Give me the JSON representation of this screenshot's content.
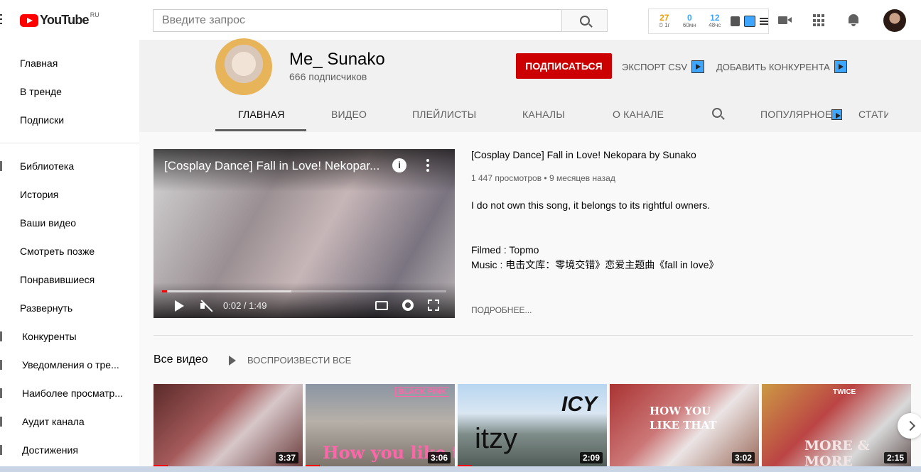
{
  "header": {
    "logo_text": "YouTube",
    "logo_region": "RU",
    "search_placeholder": "Введите запрос",
    "stats": [
      {
        "value": "27",
        "label": "⏱ 1г",
        "color": "#f0a000"
      },
      {
        "value": "0",
        "label": "60мн",
        "color": "#3ea6ff"
      },
      {
        "value": "12",
        "label": "48чс",
        "color": "#3ea6ff"
      }
    ]
  },
  "sidebar": {
    "items": [
      {
        "label": "Главная"
      },
      {
        "label": "В тренде"
      },
      {
        "label": "Подписки"
      },
      {
        "label": "Библиотека"
      },
      {
        "label": "История"
      },
      {
        "label": "Ваши видео"
      },
      {
        "label": "Смотреть позже"
      },
      {
        "label": "Понравившиеся"
      },
      {
        "label": "Развернуть"
      },
      {
        "label": "Конкуренты"
      },
      {
        "label": "Уведомления о тре..."
      },
      {
        "label": "Наиболее просматр..."
      },
      {
        "label": "Аудит канала"
      },
      {
        "label": "Достижения"
      }
    ]
  },
  "channel": {
    "name": "Me_ Sunako",
    "subscribers": "666 подписчиков",
    "subscribe_label": "ПОДПИСАТЬСЯ",
    "export_label": "ЭКСПОРТ CSV",
    "add_competitor_label": "ДОБАВИТЬ КОНКУРЕНТА",
    "tabs": [
      "ГЛАВНАЯ",
      "ВИДЕО",
      "ПЛЕЙЛИСТЫ",
      "КАНАЛЫ",
      "О КАНАЛЕ",
      "ПОПУЛЯРНОЕ",
      "СТАТИ"
    ]
  },
  "featured": {
    "player_title": "[Cosplay Dance] Fall in Love! Nekopar...",
    "time": "0:02 / 1:49",
    "progress_fraction": 0.018,
    "title": "[Cosplay Dance] Fall in Love! Nekopara by Sunako",
    "meta": "1 447 просмотров • 9 месяцев назад",
    "desc_line1": "I do not own this song, it belongs to its rightful owners.",
    "desc_line2": "Filmed : Topmo",
    "desc_line3": "Music : 电击文库：零境交错》恋爱主题曲《fall in love》",
    "more": "ПОДРОБНЕЕ..."
  },
  "videos_section": {
    "title": "Все видео",
    "play_all": "ВОСПРОИЗВЕСТИ ВСЕ",
    "items": [
      {
        "duration": "3:37",
        "overlay": "",
        "watched_fraction": 0.1
      },
      {
        "duration": "3:06",
        "overlay": "How you like tha",
        "badge": "BLACK PINK",
        "watched_fraction": 0.1
      },
      {
        "duration": "2:09",
        "overlay": "itzy",
        "badge": "ICY",
        "watched_fraction": 0.1
      },
      {
        "duration": "3:02",
        "overlay": "HOW YOU LIKE THAT",
        "watched_fraction": 0.0
      },
      {
        "duration": "2:15",
        "overlay": "MORE & MORE",
        "badge": "TWICE",
        "watched_fraction": 0.0
      }
    ]
  }
}
